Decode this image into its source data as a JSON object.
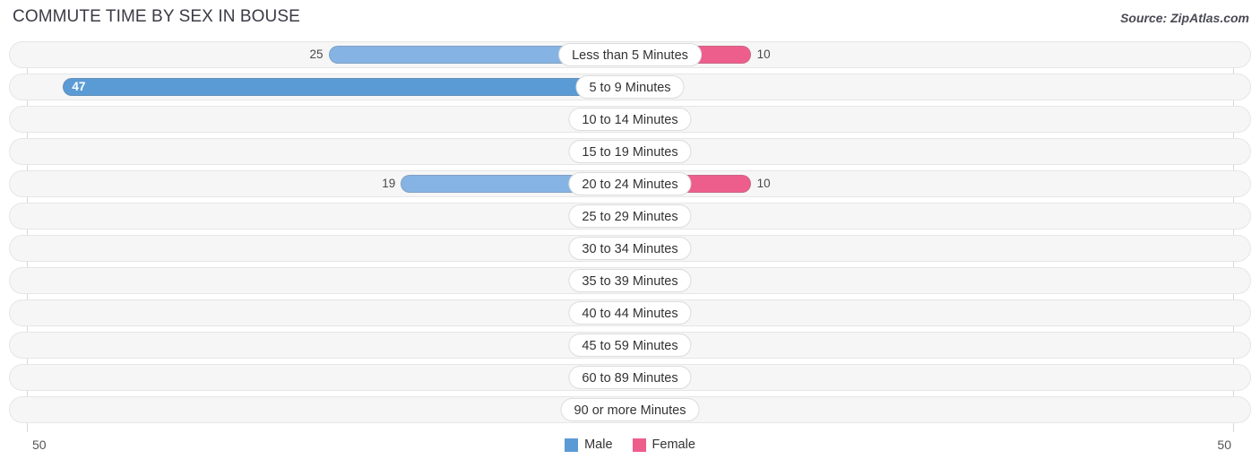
{
  "header": {
    "title": "COMMUTE TIME BY SEX IN BOUSE",
    "source": "Source: ZipAtlas.com"
  },
  "legend": {
    "male_label": "Male",
    "female_label": "Female",
    "male_color": "#5b9bd5",
    "female_color": "#ee5e8c"
  },
  "axis": {
    "left_label": "50",
    "right_label": "50",
    "max": 50
  },
  "colors": {
    "male_strong": "#5b9bd5",
    "male_light": "#a3c6ec",
    "male_mid": "#85b3e4",
    "female_strong": "#ee5e8c",
    "female_light": "#f9afc8",
    "female_mid": "#f4799f",
    "track_bg": "#f6f6f6",
    "track_border": "#e6e6e6"
  },
  "chart_data": {
    "type": "bar",
    "orientation": "horizontal-diverging",
    "title": "COMMUTE TIME BY SEX IN BOUSE",
    "xlabel": "",
    "ylabel": "",
    "xlim": [
      50,
      50
    ],
    "categories": [
      "Less than 5 Minutes",
      "5 to 9 Minutes",
      "10 to 14 Minutes",
      "15 to 19 Minutes",
      "20 to 24 Minutes",
      "25 to 29 Minutes",
      "30 to 34 Minutes",
      "35 to 39 Minutes",
      "40 to 44 Minutes",
      "45 to 59 Minutes",
      "60 to 89 Minutes",
      "90 or more Minutes"
    ],
    "series": [
      {
        "name": "Male",
        "color": "#5b9bd5",
        "values": [
          25,
          47,
          0,
          0,
          19,
          0,
          1,
          0,
          0,
          0,
          0,
          0
        ]
      },
      {
        "name": "Female",
        "color": "#ee5e8c",
        "values": [
          10,
          0,
          0,
          0,
          10,
          0,
          0,
          0,
          0,
          0,
          0,
          0
        ]
      }
    ],
    "legend_position": "bottom-center",
    "grid": false
  },
  "rows": [
    {
      "label": "Less than 5 Minutes",
      "male": "25",
      "female": "10"
    },
    {
      "label": "5 to 9 Minutes",
      "male": "47",
      "female": "0"
    },
    {
      "label": "10 to 14 Minutes",
      "male": "0",
      "female": "0"
    },
    {
      "label": "15 to 19 Minutes",
      "male": "0",
      "female": "0"
    },
    {
      "label": "20 to 24 Minutes",
      "male": "19",
      "female": "10"
    },
    {
      "label": "25 to 29 Minutes",
      "male": "0",
      "female": "0"
    },
    {
      "label": "30 to 34 Minutes",
      "male": "1",
      "female": "0"
    },
    {
      "label": "35 to 39 Minutes",
      "male": "0",
      "female": "0"
    },
    {
      "label": "40 to 44 Minutes",
      "male": "0",
      "female": "0"
    },
    {
      "label": "45 to 59 Minutes",
      "male": "0",
      "female": "0"
    },
    {
      "label": "60 to 89 Minutes",
      "male": "0",
      "female": "0"
    },
    {
      "label": "90 or more Minutes",
      "male": "0",
      "female": "0"
    }
  ]
}
